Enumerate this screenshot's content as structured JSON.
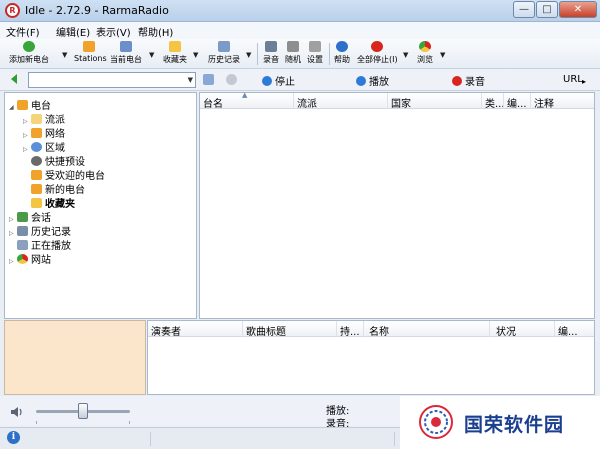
{
  "window": {
    "title": "Idle - 2.72.9 - RarmaRadio",
    "app_icon_text": "R",
    "controls": {
      "minimize": "—",
      "maximize": "□",
      "close": "✕"
    }
  },
  "menu": [
    "文件(F)",
    "编辑(E)",
    "表示(V)",
    "帮助(H)"
  ],
  "toolbar": {
    "add_station": "添加新电台",
    "stations": "Stations",
    "current_station": "当前电台",
    "favorites": "收藏夹",
    "history": "历史记录",
    "record": "录音",
    "random": "随机",
    "settings": "设置",
    "help": "帮助",
    "stop_all": "全部停止(I)",
    "browse": "浏览",
    "dropdown_arrow": "▼"
  },
  "addressbar": {
    "combo_value": "",
    "stop": "停止",
    "play": "播放",
    "record": "录音",
    "url": "URL"
  },
  "tree": [
    {
      "label": "电台",
      "expander": "◢",
      "color": "#f0a22a"
    },
    {
      "label": "流派",
      "expander": "▷",
      "color": "#f6d57a"
    },
    {
      "label": "网络",
      "expander": "▷",
      "color": "#f0a22a"
    },
    {
      "label": "区域",
      "expander": "▷",
      "color": "#5b8fd6"
    },
    {
      "label": "快捷预设",
      "expander": "",
      "color": "#6a6a6a"
    },
    {
      "label": "受欢迎的电台",
      "expander": "",
      "color": "#f0a22a"
    },
    {
      "label": "新的电台",
      "expander": "",
      "color": "#f0a22a"
    },
    {
      "label": "收藏夹",
      "expander": "",
      "color": "#f4c542"
    },
    {
      "label": "会话",
      "expander": "▷",
      "color": "#4a9a4a"
    },
    {
      "label": "历史记录",
      "expander": "▷",
      "color": "#7a8ea8"
    },
    {
      "label": "正在播放",
      "expander": "",
      "color": "#8aa0bd"
    },
    {
      "label": "网站",
      "expander": "▷",
      "color": "#d9483b"
    }
  ],
  "station_columns": [
    "台名",
    "流派",
    "国家",
    "类...",
    "编...",
    "注释"
  ],
  "sort_indicator": "▲",
  "track_columns": [
    "演奏者",
    "歌曲标题",
    "持...",
    "名称",
    "状况",
    "编..."
  ],
  "player": {
    "play_label": "播放:",
    "record_label": "录音:",
    "volume": 0.5
  },
  "status": {
    "info_icon": "i"
  },
  "watermark": {
    "text": "国荣软件园"
  },
  "colors": {
    "accent": "#2e6fc9",
    "stop": "#2e7bd6",
    "play": "#2e7bd6",
    "record": "#d9261c",
    "back_arrow": "#2e9e2e"
  }
}
